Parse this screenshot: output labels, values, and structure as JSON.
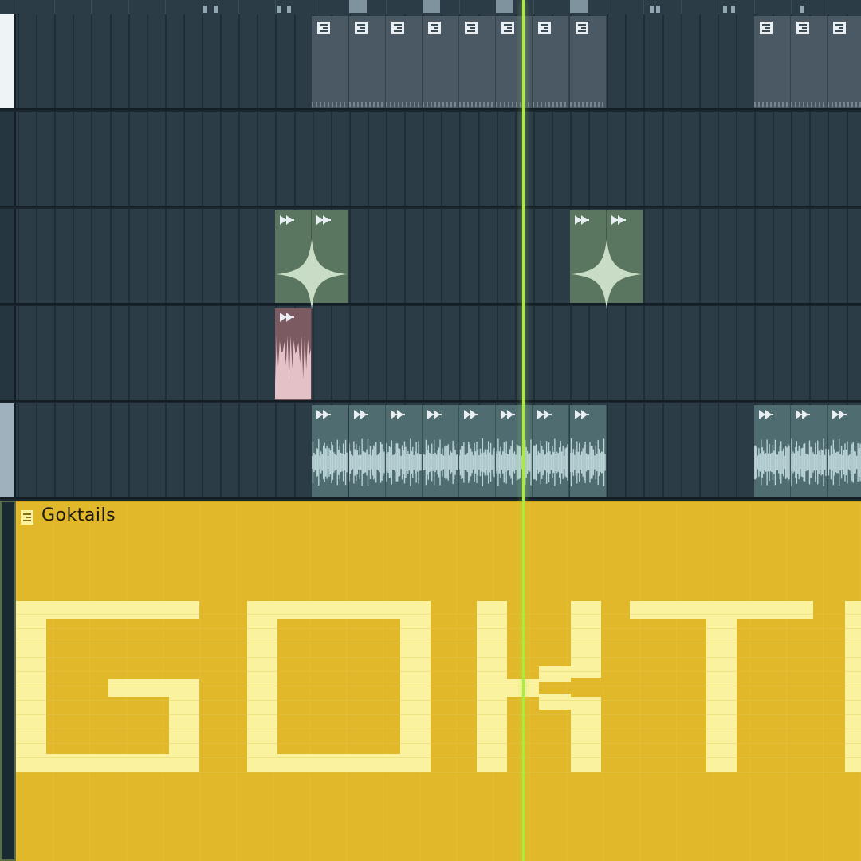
{
  "pattern_block": {
    "title": "Goktails",
    "big_text": "GOKT"
  },
  "colors": {
    "playhead": "#a8ec3c",
    "pattern_clip": "#e2b82b",
    "pattern_clip_ink": "#fbf2a0",
    "audio_green": "#5a7660",
    "audio_pink": "#7b5a61",
    "audio_teal": "#4f6d70",
    "grid_dark": "#2b3c47"
  },
  "icons": {
    "pattern_clip": "pattern-icon",
    "audio_clip": "audio-clip-icon"
  }
}
